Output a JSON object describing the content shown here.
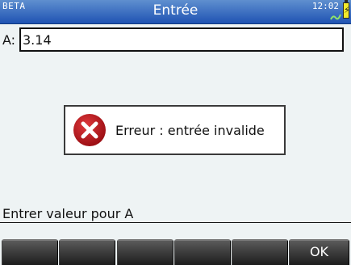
{
  "statusbar": {
    "badge": "BETA",
    "title": "Entrée",
    "time": "12:02",
    "battery_icon": "battery-charging-icon",
    "signal_icon": "wireless-link-icon"
  },
  "input": {
    "label": "A:",
    "value": "3.14"
  },
  "dialog": {
    "icon": "error-x-icon",
    "message": "Erreur : entrée invalide"
  },
  "help_text": "Entrer valeur pour A",
  "softkeys": [
    "",
    "",
    "",
    "",
    "",
    "OK"
  ],
  "colors": {
    "header": "#2a5fbd",
    "error_red": "#b31217",
    "screen_bg": "#eef3f4",
    "softkey_bg": "#2e2e2e"
  }
}
